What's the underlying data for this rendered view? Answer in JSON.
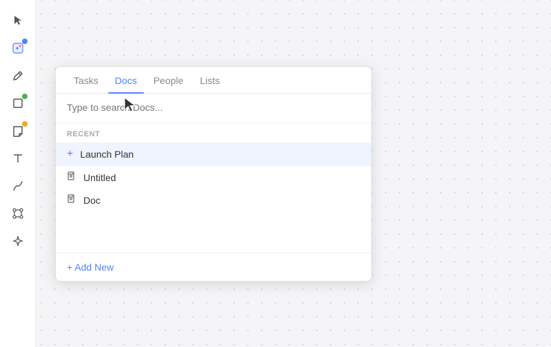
{
  "toolbar": {
    "items": [
      {
        "name": "cursor-tool",
        "icon": "arrow",
        "badge": null
      },
      {
        "name": "ai-tool",
        "icon": "ai",
        "badge": "blue"
      },
      {
        "name": "pen-tool",
        "icon": "pen",
        "badge": null
      },
      {
        "name": "shape-tool",
        "icon": "square",
        "badge": "green"
      },
      {
        "name": "sticky-tool",
        "icon": "sticky",
        "badge": "yellow"
      },
      {
        "name": "text-tool",
        "icon": "text",
        "badge": null
      },
      {
        "name": "draw-tool",
        "icon": "draw",
        "badge": null
      },
      {
        "name": "connect-tool",
        "icon": "connect",
        "badge": null
      },
      {
        "name": "magic-tool",
        "icon": "magic",
        "badge": null
      }
    ]
  },
  "popup": {
    "tabs": [
      {
        "id": "tasks",
        "label": "Tasks",
        "active": false
      },
      {
        "id": "docs",
        "label": "Docs",
        "active": true
      },
      {
        "id": "people",
        "label": "People",
        "active": false
      },
      {
        "id": "lists",
        "label": "Lists",
        "active": false
      }
    ],
    "search_placeholder": "Type to search Docs...",
    "recent_label": "RECENT",
    "items": [
      {
        "id": "launch-plan",
        "label": "Launch Plan",
        "type": "plus",
        "highlighted": true
      },
      {
        "id": "untitled",
        "label": "Untitled",
        "type": "doc",
        "highlighted": false
      },
      {
        "id": "doc",
        "label": "Doc",
        "type": "doc",
        "highlighted": false
      }
    ],
    "add_new_label": "+ Add New"
  }
}
